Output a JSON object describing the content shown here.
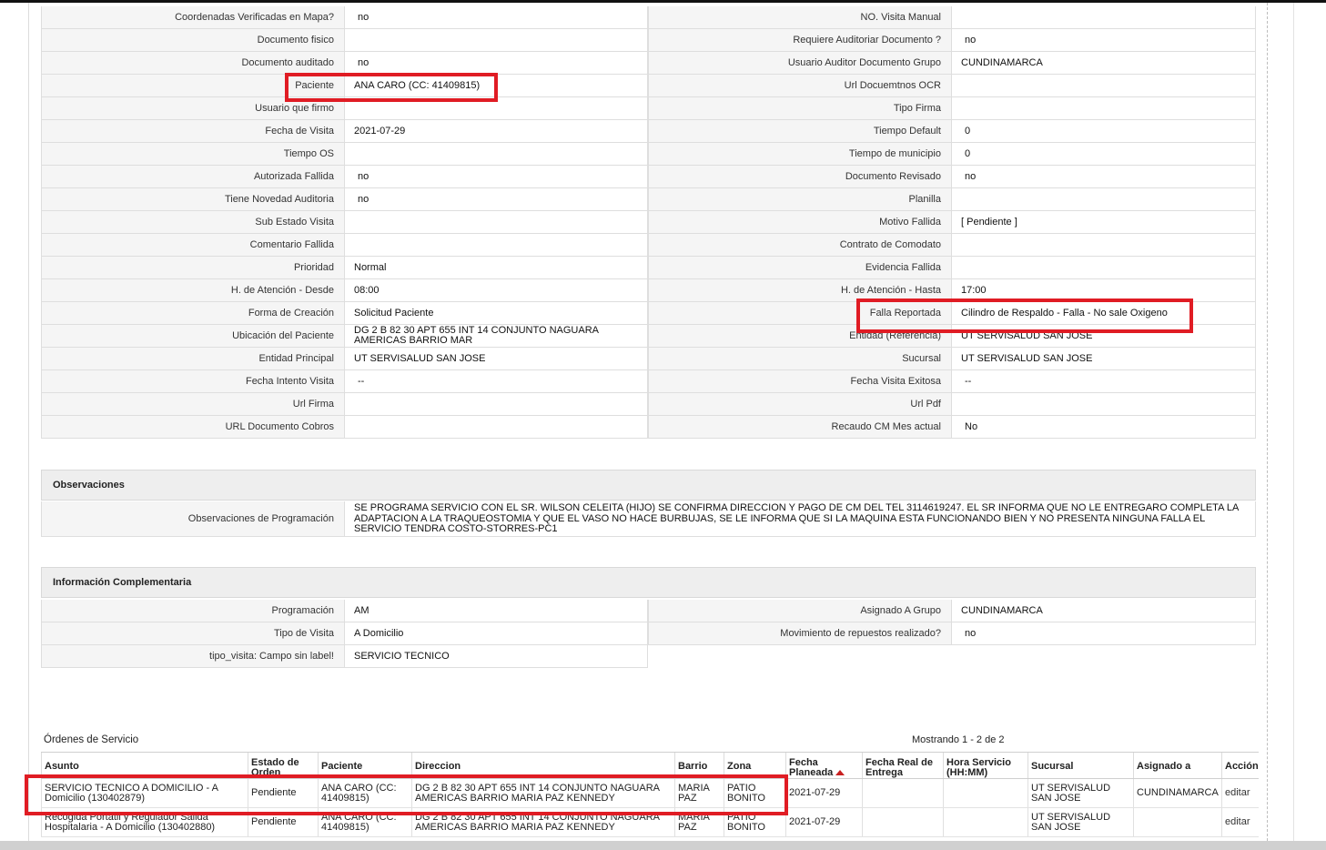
{
  "general": {
    "rows": [
      {
        "l1": "Coordenadas Verificadas en Mapa?",
        "v1": "no",
        "l2": "NO. Visita Manual",
        "v2": ""
      },
      {
        "l1": "Documento fisico",
        "v1": "",
        "l2": "Requiere Auditoriar Documento ?",
        "v2": "no"
      },
      {
        "l1": "Documento auditado",
        "v1": "no",
        "l2": "Usuario Auditor Documento Grupo",
        "v2": "CUNDINAMARCA"
      },
      {
        "l1": "Paciente",
        "v1": "ANA CARO (CC: 41409815)",
        "l2": "Url Docuemtnos OCR",
        "v2": ""
      },
      {
        "l1": "Usuario que firmo",
        "v1": "",
        "l2": "Tipo Firma",
        "v2": ""
      },
      {
        "l1": "Fecha de Visita",
        "v1": "2021-07-29",
        "l2": "Tiempo Default",
        "v2": "0"
      },
      {
        "l1": "Tiempo OS",
        "v1": "",
        "l2": "Tiempo de municipio",
        "v2": "0"
      },
      {
        "l1": "Autorizada Fallida",
        "v1": "no",
        "l2": "Documento Revisado",
        "v2": "no"
      },
      {
        "l1": "Tiene Novedad Auditoria",
        "v1": "no",
        "l2": "Planilla",
        "v2": ""
      },
      {
        "l1": "Sub Estado Visita",
        "v1": "",
        "l2": "Motivo Fallida",
        "v2": "[ Pendiente ]"
      },
      {
        "l1": "Comentario Fallida",
        "v1": "",
        "l2": "Contrato de Comodato",
        "v2": ""
      },
      {
        "l1": "Prioridad",
        "v1": "Normal",
        "l2": "Evidencia Fallida",
        "v2": ""
      },
      {
        "l1": "H. de Atención - Desde",
        "v1": "08:00",
        "l2": "H. de Atención - Hasta",
        "v2": "17:00"
      },
      {
        "l1": "Forma de Creación",
        "v1": "Solicitud Paciente",
        "l2": "Falla Reportada",
        "v2": "Cilindro de Respaldo - Falla - No sale Oxigeno"
      },
      {
        "l1": "Ubicación del Paciente",
        "v1": "DG 2 B 82 30 APT 655 INT 14 CONJUNTO NAGUARA AMERICAS BARRIO MAR",
        "l2": "Entidad (Referencia)",
        "v2": "UT SERVISALUD SAN JOSE"
      },
      {
        "l1": "Entidad Principal",
        "v1": "UT SERVISALUD SAN JOSE",
        "l2": "Sucursal",
        "v2": "UT SERVISALUD SAN JOSE"
      },
      {
        "l1": "Fecha Intento Visita",
        "v1": "--",
        "l2": "Fecha Visita Exitosa",
        "v2": "--"
      },
      {
        "l1": "Url Firma",
        "v1": "",
        "l2": "Url Pdf",
        "v2": ""
      },
      {
        "l1": "URL Documento Cobros",
        "v1": "",
        "l2": "Recaudo CM Mes actual",
        "v2": "No"
      }
    ]
  },
  "observaciones": {
    "title": "Observaciones",
    "label": "Observaciones de Programación",
    "value": " SE PROGRAMA SERVICIO CON EL SR. WILSON CELEITA (HIJO) SE CONFIRMA DIRECCION Y PAGO DE CM DEL TEL 3114619247. EL SR INFORMA QUE NO LE ENTREGARO COMPLETA LA ADAPTACION A LA TRAQUEOSTOMIA Y QUE EL VASO NO HACE BURBUJAS, SE LE INFORMA QUE SI LA MAQUINA ESTA FUNCIONANDO BIEN Y NO PRESENTA NINGUNA FALLA EL SERVICIO TENDRA COSTO-STORRES-PC1"
  },
  "complementaria": {
    "title": "Información Complementaria",
    "rows": [
      {
        "l1": "Programación",
        "v1": "AM",
        "l2": "Asignado A Grupo",
        "v2": "CUNDINAMARCA"
      },
      {
        "l1": "Tipo de Visita",
        "v1": "A Domicilio",
        "l2": "Movimiento de repuestos realizado?",
        "v2": "no"
      },
      {
        "l1": "tipo_visita: Campo sin label!",
        "v1": "SERVICIO TECNICO"
      }
    ]
  },
  "ordenes": {
    "title": "Órdenes de Servicio",
    "count": "Mostrando 1 - 2 de 2",
    "headers": [
      "Asunto",
      "Estado de Orden",
      "Paciente",
      "Direccion",
      "Barrio",
      "Zona",
      "Fecha Planeada",
      "Fecha Real de Entrega",
      "Hora Servicio (HH:MM)",
      "Sucursal",
      "Asignado a",
      "Acción"
    ],
    "rows": [
      {
        "asunto": "SERVICIO TECNICO A DOMICILIO - A Domicilio (130402879)",
        "estado": "Pendiente",
        "paciente": "ANA CARO (CC: 41409815)",
        "direccion": "DG 2 B 82 30 APT 655 INT 14 CONJUNTO NAGUARA AMERICAS BARRIO MARIA PAZ KENNEDY",
        "barrio": "MARIA PAZ",
        "zona": "PATIO BONITO",
        "fecha_planeada": "2021-07-29",
        "fecha_real": "",
        "hora": "",
        "sucursal": "UT SERVISALUD SAN JOSE",
        "asignado": "CUNDINAMARCA",
        "accion": "editar"
      },
      {
        "asunto": "Recogida Portatil y Regulador Salida Hospitalaria - A Domicilio (130402880)",
        "estado": "Pendiente",
        "paciente": "ANA CARO (CC: 41409815)",
        "direccion": "DG 2 B 82 30 APT 655 INT 14 CONJUNTO NAGUARA AMERICAS BARRIO MARIA PAZ KENNEDY",
        "barrio": "MARIA PAZ",
        "zona": "PATIO BONITO",
        "fecha_planeada": "2021-07-29",
        "fecha_real": "",
        "hora": "",
        "sucursal": "UT SERVISALUD SAN JOSE",
        "asignado": "",
        "accion": "editar"
      }
    ]
  },
  "colors": {
    "highlight": "#e01c24",
    "label_bg": "#f5f5f5",
    "header_bg": "#eeeeee"
  }
}
